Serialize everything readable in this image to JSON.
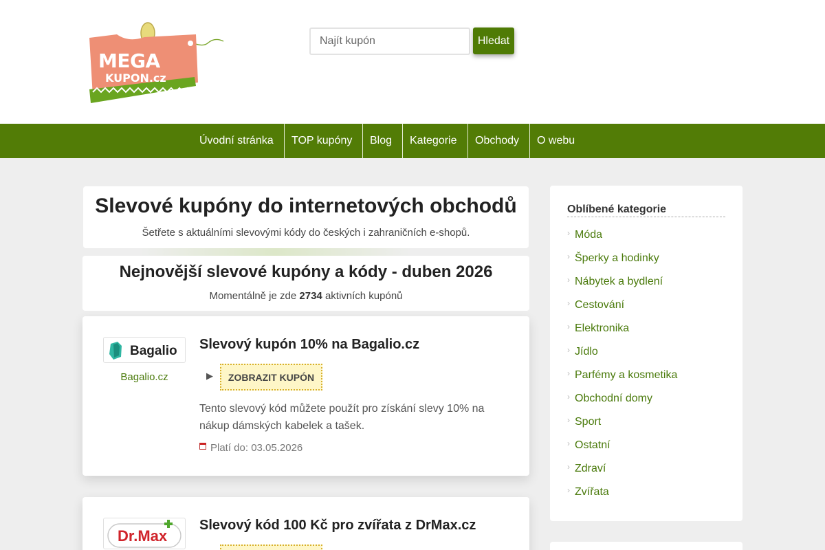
{
  "brand": {
    "logo_text_top": "MEGA",
    "logo_text_bottom": "KUPON.cz"
  },
  "search": {
    "placeholder": "Najít kupón",
    "button_label": "Hledat"
  },
  "nav": {
    "items": [
      {
        "label": "Úvodní stránka"
      },
      {
        "label": "TOP kupóny"
      },
      {
        "label": "Blog"
      },
      {
        "label": "Kategorie"
      },
      {
        "label": "Obchody"
      },
      {
        "label": "O webu"
      }
    ]
  },
  "hero": {
    "title": "Slevové kupóny do internetových obchodů",
    "subtitle": "Šetřete s aktuálními slevovými kódy do českých i zahraničních e-shopů."
  },
  "latest": {
    "title": "Nejnovější slevové kupóny a kódy - duben 2026",
    "count_prefix": "Momentálně je zde",
    "count": "2734",
    "count_suffix": "aktivních kupónů"
  },
  "coupons": [
    {
      "shop_logo_text": "Bagalio",
      "shop_name": "Bagalio.cz",
      "title": "Slevový kupón 10% na Bagalio.cz",
      "reveal_label": "ZOBRAZIT KUPÓN",
      "description": "Tento slevový kód můžete použít pro získání slevy 10% na nákup dámských kabelek a tašek.",
      "validity": "Platí do: 03.05.2026"
    },
    {
      "shop_logo_text": "Dr.Max",
      "title": "Slevový kód 100 Kč pro zvířata z DrMax.cz"
    }
  ],
  "sidebar": {
    "title": "Oblíbené kategorie",
    "categories": [
      {
        "label": "Móda"
      },
      {
        "label": "Šperky a hodinky"
      },
      {
        "label": "Nábytek a bydlení"
      },
      {
        "label": "Cestování"
      },
      {
        "label": "Elektronika"
      },
      {
        "label": "Jídlo"
      },
      {
        "label": "Parfémy a kosmetika"
      },
      {
        "label": "Obchodní domy"
      },
      {
        "label": "Sport"
      },
      {
        "label": "Ostatní"
      },
      {
        "label": "Zdraví"
      },
      {
        "label": "Zvířata"
      }
    ]
  },
  "colors": {
    "nav_background": "#527c06",
    "link_green": "#4a7a0b",
    "logo_tag": "#ee8f75",
    "reveal_button_bg": "#fef6c7"
  }
}
